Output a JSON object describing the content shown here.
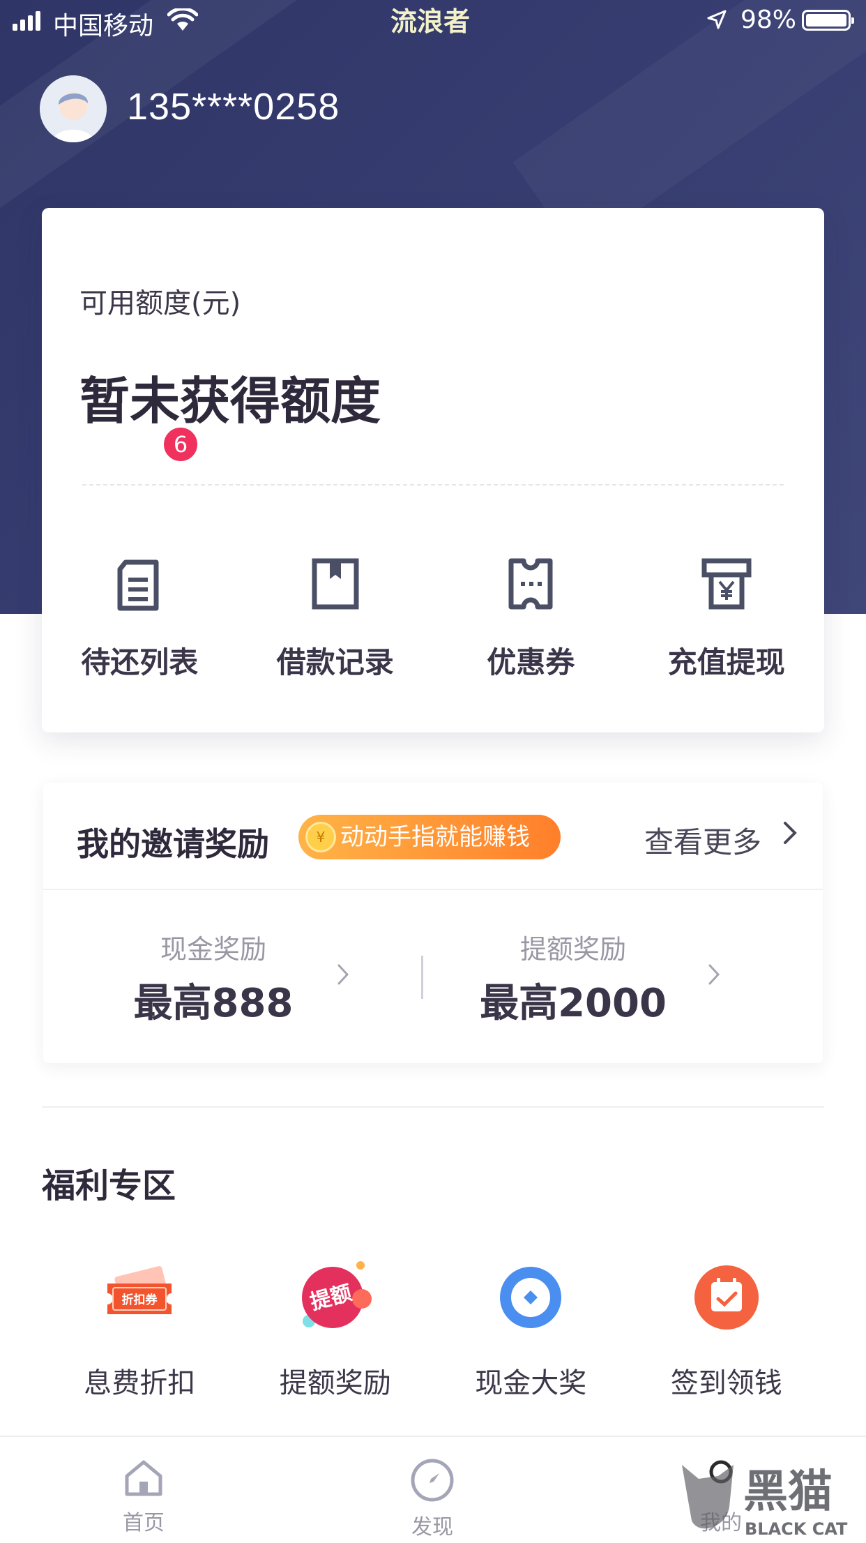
{
  "status_bar": {
    "carrier": "中国移动",
    "time": "流浪者",
    "battery": "98%"
  },
  "user": {
    "phone": "135****0258"
  },
  "quota": {
    "label": "可用额度(元)",
    "value": "暂未获得额度",
    "actions": [
      {
        "label": "待还列表",
        "icon": "bill-list-icon",
        "badge": "6"
      },
      {
        "label": "借款记录",
        "icon": "bookmark-record-icon"
      },
      {
        "label": "优惠券",
        "icon": "coupon-ticket-icon"
      },
      {
        "label": "充值提现",
        "icon": "yuan-withdraw-icon"
      }
    ]
  },
  "invite": {
    "title": "我的邀请奖励",
    "pill": "动动手指就能赚钱",
    "more": "查看更多",
    "rewards": [
      {
        "label": "现金奖励",
        "value": "最高888"
      },
      {
        "label": "提额奖励",
        "value": "最高2000"
      }
    ]
  },
  "welfare": {
    "title": "福利专区",
    "items": [
      {
        "label": "息费折扣",
        "icon": "discount-ticket-icon",
        "icon_text": "折扣券"
      },
      {
        "label": "提额奖励",
        "icon": "raise-quota-icon",
        "icon_text": "提额"
      },
      {
        "label": "现金大奖",
        "icon": "cash-prize-icon"
      },
      {
        "label": "签到领钱",
        "icon": "calendar-checkin-icon"
      }
    ]
  },
  "tabs": [
    {
      "label": "首页",
      "icon": "home-icon"
    },
    {
      "label": "发现",
      "icon": "compass-icon"
    },
    {
      "label": "我的",
      "icon": "profile-icon"
    }
  ],
  "watermark": {
    "cn": "黑猫",
    "en": "BLACK CAT"
  },
  "colors": {
    "header": "#353b6e",
    "badge": "#f0315d",
    "pill_start": "#ffb347",
    "pill_end": "#ff7f2a",
    "text_dark": "#2f2a3b"
  }
}
